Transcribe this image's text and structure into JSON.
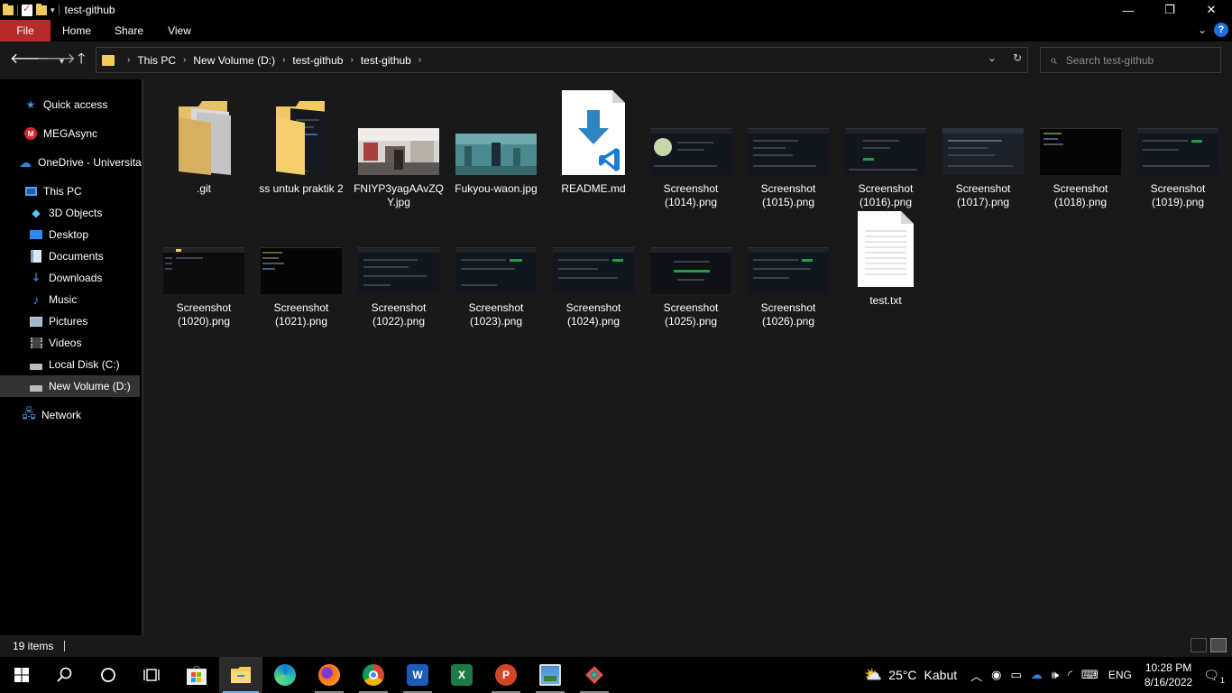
{
  "window": {
    "title": "test-github",
    "controls": {
      "minimize": "—",
      "maximize": "❐",
      "close": "✕"
    }
  },
  "ribbon": {
    "tabs": [
      "File",
      "Home",
      "Share",
      "View"
    ],
    "help": "?"
  },
  "address": {
    "crumbs": [
      "This PC",
      "New Volume (D:)",
      "test-github",
      "test-github"
    ],
    "search_placeholder": "Search test-github"
  },
  "sidebar": {
    "items": [
      {
        "label": "Quick access",
        "icon": "star-icon"
      },
      {
        "label": "MEGAsync",
        "icon": "mega-icon"
      },
      {
        "label": "OneDrive - Universita",
        "icon": "onedrive-icon"
      },
      {
        "label": "This PC",
        "icon": "pc-icon"
      },
      {
        "label": "3D Objects",
        "icon": "cube-icon"
      },
      {
        "label": "Desktop",
        "icon": "desktop-icon"
      },
      {
        "label": "Documents",
        "icon": "documents-icon"
      },
      {
        "label": "Downloads",
        "icon": "download-icon"
      },
      {
        "label": "Music",
        "icon": "music-icon"
      },
      {
        "label": "Pictures",
        "icon": "pictures-icon"
      },
      {
        "label": "Videos",
        "icon": "videos-icon"
      },
      {
        "label": "Local Disk (C:)",
        "icon": "drive-icon"
      },
      {
        "label": "New Volume (D:)",
        "icon": "drive-icon",
        "selected": true
      },
      {
        "label": "Network",
        "icon": "network-icon"
      }
    ]
  },
  "files": [
    {
      "name": ".git",
      "type": "folder-plain"
    },
    {
      "name": "ss untuk praktik 2",
      "type": "folder-content"
    },
    {
      "name": "FNIYP3yagAAvZQY.jpg",
      "type": "photo-room"
    },
    {
      "name": "Fukyou-waon.jpg",
      "type": "photo-teal"
    },
    {
      "name": "README.md",
      "type": "vscode-doc"
    },
    {
      "name": "Screenshot (1014).png",
      "type": "screenshot"
    },
    {
      "name": "Screenshot (1015).png",
      "type": "screenshot"
    },
    {
      "name": "Screenshot (1016).png",
      "type": "screenshot"
    },
    {
      "name": "Screenshot (1017).png",
      "type": "screenshot"
    },
    {
      "name": "Screenshot (1018).png",
      "type": "screenshot-dark"
    },
    {
      "name": "Screenshot (1019).png",
      "type": "screenshot"
    },
    {
      "name": "Screenshot (1020).png",
      "type": "screenshot"
    },
    {
      "name": "Screenshot (1021).png",
      "type": "screenshot-dark"
    },
    {
      "name": "Screenshot (1022).png",
      "type": "screenshot"
    },
    {
      "name": "Screenshot (1023).png",
      "type": "screenshot"
    },
    {
      "name": "Screenshot (1024).png",
      "type": "screenshot"
    },
    {
      "name": "Screenshot (1025).png",
      "type": "screenshot"
    },
    {
      "name": "Screenshot (1026).png",
      "type": "screenshot"
    },
    {
      "name": "test.txt",
      "type": "text-doc"
    }
  ],
  "status": {
    "item_count": "19 items"
  },
  "taskbar": {
    "apps": [
      "start-icon",
      "search-icon",
      "cortana-icon",
      "task-view-icon",
      "store-icon",
      "file-explorer-icon",
      "edge-icon",
      "firefox-icon",
      "chrome-icon",
      "word-icon",
      "excel-icon",
      "powerpoint-icon",
      "photos-icon",
      "git-icon"
    ],
    "weather_temp": "25°C",
    "weather_text": "Kabut",
    "language": "ENG",
    "time": "10:28 PM",
    "date": "8/16/2022",
    "notifications": "1"
  },
  "colors": {
    "accent_file_tab": "#b52b2b",
    "folder": "#f4c95d",
    "selection": "#333333",
    "taskbar_active": "#77b4f0"
  }
}
